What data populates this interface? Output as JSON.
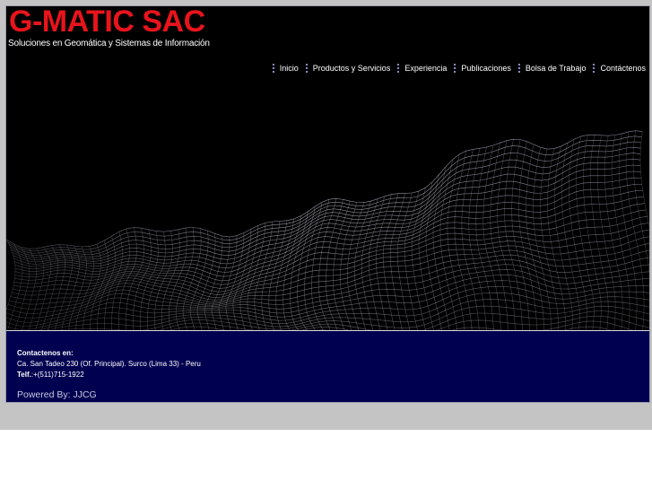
{
  "header": {
    "logo_text": "G-MATIC SAC",
    "tagline": "Soluciones en Geomática y Sistemas de Información"
  },
  "nav": {
    "items": [
      {
        "label": "Inicio"
      },
      {
        "label": "Productos y Servicios"
      },
      {
        "label": "Experiencia"
      },
      {
        "label": "Publicaciones"
      },
      {
        "label": "Bolsa de Trabajo"
      },
      {
        "label": "Contáctenos"
      }
    ]
  },
  "hero": {
    "image": "wireframe-terrain-mesh"
  },
  "footer": {
    "title": "Contactenos en:",
    "address": "Ca. San Tadeo 230 (Of. Principal). Surco (Lima 33) - Peru",
    "tel_label": "Telf.",
    "tel_value": ":+(511)715-1922",
    "powered": "Powered By: JJCG"
  },
  "colors": {
    "logo": "#e8141c",
    "footer_bg": "#000050",
    "page_bg": "#c4c4c4",
    "separator": "#8d8dc8"
  }
}
